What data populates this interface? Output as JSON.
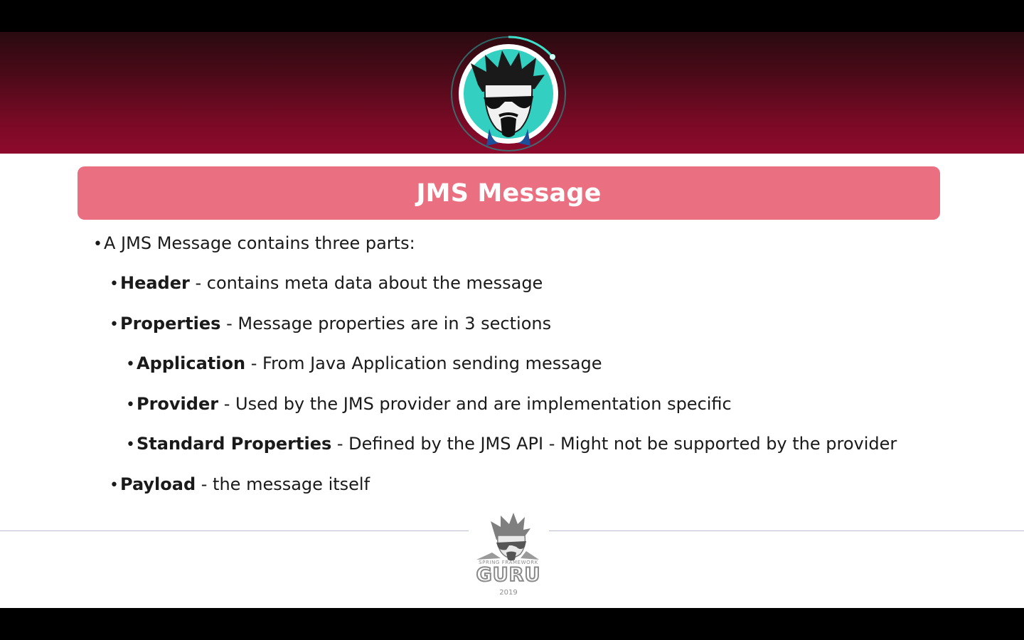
{
  "slide": {
    "title": "JMS Message",
    "bullets": [
      {
        "level": 1,
        "dot": "•",
        "term": "",
        "text": "A JMS Message contains three parts:"
      },
      {
        "level": 2,
        "dot": "•",
        "term": "Header",
        "text": " - contains meta data about the message"
      },
      {
        "level": 2,
        "dot": "•",
        "term": "Properties",
        "text": " - Message properties are in 3 sections"
      },
      {
        "level": 3,
        "dot": "•",
        "term": "Application",
        "text": " - From Java Application sending message"
      },
      {
        "level": 3,
        "dot": "•",
        "term": "Provider",
        "text": " - Used by the JMS provider and are implementation specific"
      },
      {
        "level": 3,
        "dot": "•",
        "term": "Standard Properties",
        "text": " - Defined by the JMS API - Might not be supported by the provider"
      },
      {
        "level": 2,
        "dot": "•",
        "term": "Payload",
        "text": " - the message itself"
      }
    ]
  },
  "logo": {
    "tagline": "SPRING FRAMEWORK",
    "wordmark": "GURU",
    "year": "2019"
  },
  "colors": {
    "header_dark": "#2a0b10",
    "header_red": "#8e0a2c",
    "title_bar": "#ea6f80",
    "avatar_ring": "#2fc7b3",
    "avatar_face_bg": "#3ad1c2"
  }
}
